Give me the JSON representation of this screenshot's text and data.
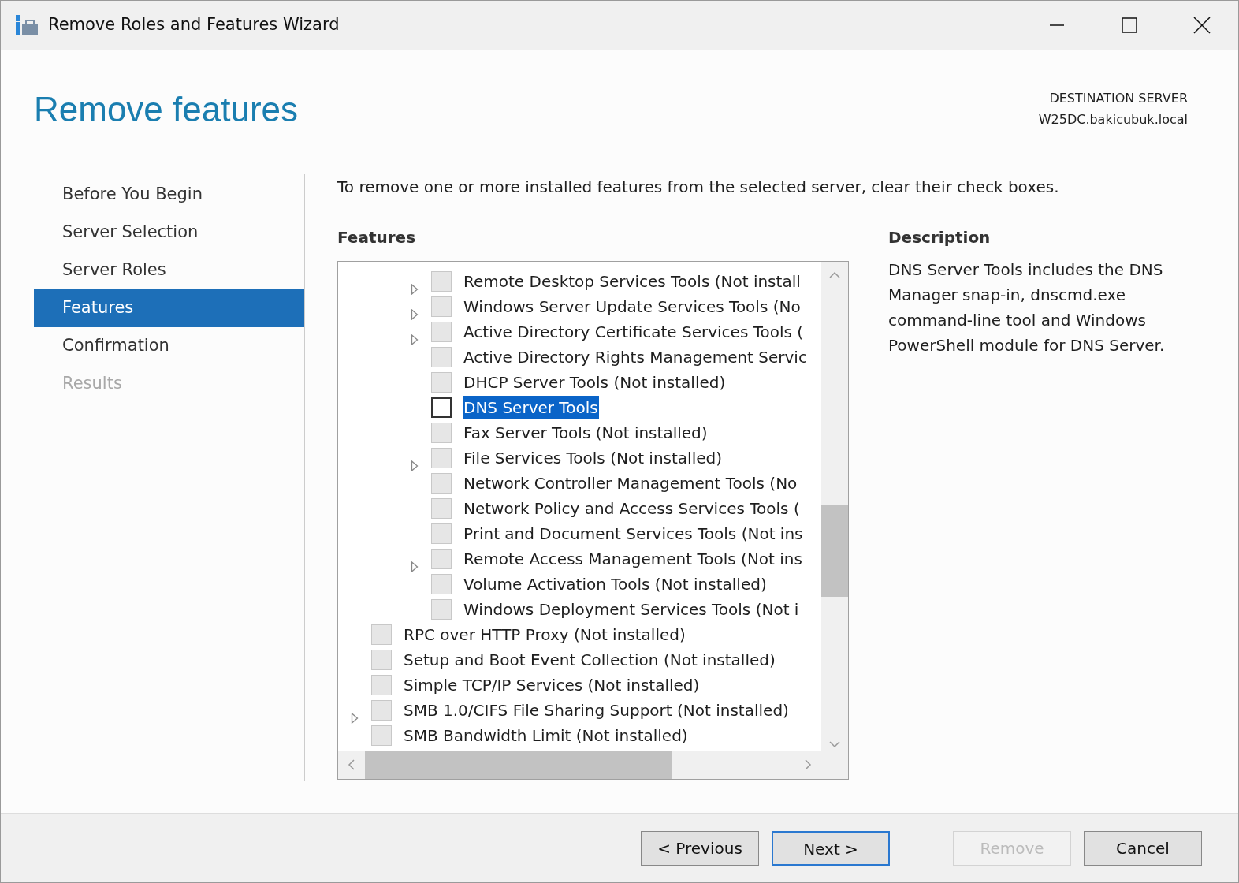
{
  "window": {
    "title": "Remove Roles and Features Wizard"
  },
  "header": {
    "title": "Remove features",
    "destination_label": "DESTINATION SERVER",
    "destination_server": "W25DC.bakicubuk.local"
  },
  "steps": [
    {
      "label": "Before You Begin",
      "selected": false,
      "disabled": false
    },
    {
      "label": "Server Selection",
      "selected": false,
      "disabled": false
    },
    {
      "label": "Server Roles",
      "selected": false,
      "disabled": false
    },
    {
      "label": "Features",
      "selected": true,
      "disabled": false
    },
    {
      "label": "Confirmation",
      "selected": false,
      "disabled": false
    },
    {
      "label": "Results",
      "selected": false,
      "disabled": true
    }
  ],
  "instruction": "To remove one or more installed features from the selected server, clear their check boxes.",
  "features": {
    "heading": "Features",
    "nested_items": [
      {
        "label": "Remote Desktop Services Tools (Not install",
        "expandable": true,
        "checked": false,
        "disabled": true,
        "selected": false
      },
      {
        "label": "Windows Server Update Services Tools (No",
        "expandable": true,
        "checked": false,
        "disabled": true,
        "selected": false
      },
      {
        "label": "Active Directory Certificate Services Tools (",
        "expandable": true,
        "checked": false,
        "disabled": true,
        "selected": false
      },
      {
        "label": "Active Directory Rights Management Servic",
        "expandable": false,
        "checked": false,
        "disabled": true,
        "selected": false
      },
      {
        "label": "DHCP Server Tools (Not installed)",
        "expandable": false,
        "checked": false,
        "disabled": true,
        "selected": false
      },
      {
        "label": "DNS Server Tools",
        "expandable": false,
        "checked": false,
        "disabled": false,
        "selected": true
      },
      {
        "label": "Fax Server Tools (Not installed)",
        "expandable": false,
        "checked": false,
        "disabled": true,
        "selected": false
      },
      {
        "label": "File Services Tools (Not installed)",
        "expandable": true,
        "checked": false,
        "disabled": true,
        "selected": false
      },
      {
        "label": "Network Controller Management Tools (No",
        "expandable": false,
        "checked": false,
        "disabled": true,
        "selected": false
      },
      {
        "label": "Network Policy and Access Services Tools (",
        "expandable": false,
        "checked": false,
        "disabled": true,
        "selected": false
      },
      {
        "label": "Print and Document Services Tools (Not ins",
        "expandable": false,
        "checked": false,
        "disabled": true,
        "selected": false
      },
      {
        "label": "Remote Access Management Tools (Not ins",
        "expandable": true,
        "checked": false,
        "disabled": true,
        "selected": false
      },
      {
        "label": "Volume Activation Tools (Not installed)",
        "expandable": false,
        "checked": false,
        "disabled": true,
        "selected": false
      },
      {
        "label": "Windows Deployment Services Tools (Not i",
        "expandable": false,
        "checked": false,
        "disabled": true,
        "selected": false
      }
    ],
    "items": [
      {
        "label": "RPC over HTTP Proxy (Not installed)",
        "expandable": false,
        "checked": false,
        "disabled": true,
        "selected": false
      },
      {
        "label": "Setup and Boot Event Collection (Not installed)",
        "expandable": false,
        "checked": false,
        "disabled": true,
        "selected": false
      },
      {
        "label": "Simple TCP/IP Services (Not installed)",
        "expandable": false,
        "checked": false,
        "disabled": true,
        "selected": false
      },
      {
        "label": "SMB 1.0/CIFS File Sharing Support (Not installed)",
        "expandable": true,
        "checked": false,
        "disabled": true,
        "selected": false
      },
      {
        "label": "SMB Bandwidth Limit (Not installed)",
        "expandable": false,
        "checked": false,
        "disabled": true,
        "selected": false
      }
    ]
  },
  "description": {
    "heading": "Description",
    "text": "DNS Server Tools includes the DNS Manager snap-in, dnscmd.exe command-line tool and Windows PowerShell module for DNS Server."
  },
  "buttons": [
    {
      "label": "< Previous",
      "disabled": false,
      "default": false
    },
    {
      "label": "Next >",
      "disabled": false,
      "default": true
    },
    {
      "label": "Remove",
      "disabled": true,
      "default": false
    },
    {
      "label": "Cancel",
      "disabled": false,
      "default": false
    }
  ]
}
